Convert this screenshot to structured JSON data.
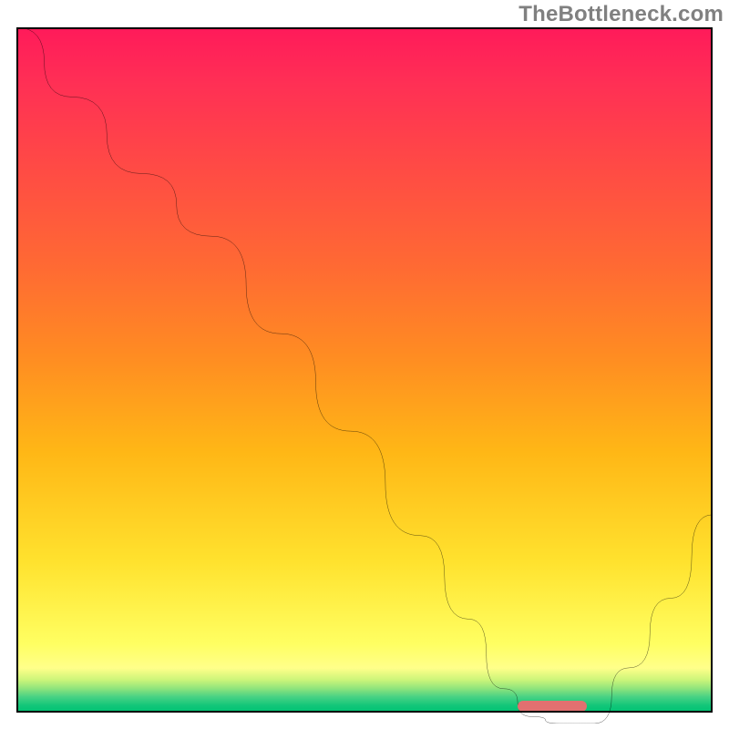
{
  "watermark": "TheBottleneck.com",
  "chart_data": {
    "type": "line",
    "title": "",
    "xlabel": "",
    "ylabel": "",
    "xlim": [
      0,
      100
    ],
    "ylim": [
      0,
      100
    ],
    "grid": false,
    "series": [
      {
        "name": "bottleneck-curve",
        "x": [
          0,
          8,
          18,
          28,
          38,
          48,
          58,
          65,
          70,
          74,
          78,
          83,
          88,
          94,
          100
        ],
        "y": [
          100,
          90,
          79,
          70,
          56,
          42,
          27,
          15,
          5,
          1,
          0,
          0,
          8,
          18,
          30
        ]
      }
    ],
    "optimum_range_x": [
      72,
      82
    ],
    "gradient_stops": [
      {
        "pos": 0.0,
        "color": "#ff1a5a"
      },
      {
        "pos": 0.35,
        "color": "#ff6a33"
      },
      {
        "pos": 0.62,
        "color": "#ffb716"
      },
      {
        "pos": 0.9,
        "color": "#ffff62"
      },
      {
        "pos": 1.0,
        "color": "#00c273"
      }
    ]
  }
}
